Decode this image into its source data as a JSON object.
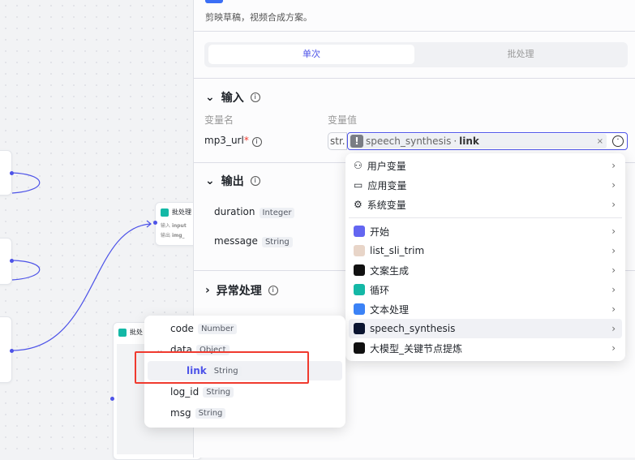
{
  "canvas": {
    "nodes": [
      {
        "title": "批处理",
        "inputs_label": "输入",
        "input_tag": "input",
        "outputs_label": "输出",
        "output_tag": "img_"
      },
      {
        "title": "批处"
      }
    ]
  },
  "panel": {
    "description": "剪映草稿，视频合成方案。",
    "tabs": [
      {
        "label": "单次",
        "active": true
      },
      {
        "label": "批处理",
        "active": false
      }
    ],
    "input_section": {
      "title": "输入",
      "col_name": "变量名",
      "col_value": "变量值",
      "param": {
        "name": "mp3_url",
        "required": true,
        "type_prefix": "str.",
        "ref_node": "speech_synthesis",
        "ref_sep": "·",
        "ref_field": "link"
      }
    },
    "output_section": {
      "title": "输出",
      "fields": [
        {
          "name": "duration",
          "type": "Integer"
        },
        {
          "name": "message",
          "type": "String"
        }
      ]
    },
    "error_section": {
      "title": "异常处理"
    }
  },
  "var_menu": {
    "groups": [
      {
        "label": "用户变量",
        "icon": "user-icon"
      },
      {
        "label": "应用变量",
        "icon": "folder-icon"
      },
      {
        "label": "系统变量",
        "icon": "gear-icon"
      }
    ],
    "nodes": [
      {
        "label": "开始",
        "icon": "start-icon",
        "color": "#6366f1"
      },
      {
        "label": "list_sli_trim",
        "icon": "avatar-icon",
        "color": "#e8d5c8"
      },
      {
        "label": "文案生成",
        "icon": "llm-icon",
        "color": "#111111"
      },
      {
        "label": "循环",
        "icon": "loop-icon",
        "color": "#14b8a6"
      },
      {
        "label": "文本处理",
        "icon": "text-process-icon",
        "color": "#3b82f6"
      },
      {
        "label": "speech_synthesis",
        "icon": "audio-icon",
        "color": "#0b1530",
        "hover": true
      },
      {
        "label": "大模型_关键节点提炼",
        "icon": "llm-icon",
        "color": "#111111"
      }
    ]
  },
  "field_menu": {
    "items": [
      {
        "name": "code",
        "type": "Number",
        "level": 0
      },
      {
        "name": "data",
        "type": "Object",
        "level": 0,
        "expanded": true
      },
      {
        "name": "link",
        "type": "String",
        "level": 1,
        "selected": true
      },
      {
        "name": "log_id",
        "type": "String",
        "level": 0
      },
      {
        "name": "msg",
        "type": "String",
        "level": 0
      }
    ]
  },
  "colors": {
    "accent": "#4d53e8",
    "highlight_box": "#f03a2e"
  }
}
